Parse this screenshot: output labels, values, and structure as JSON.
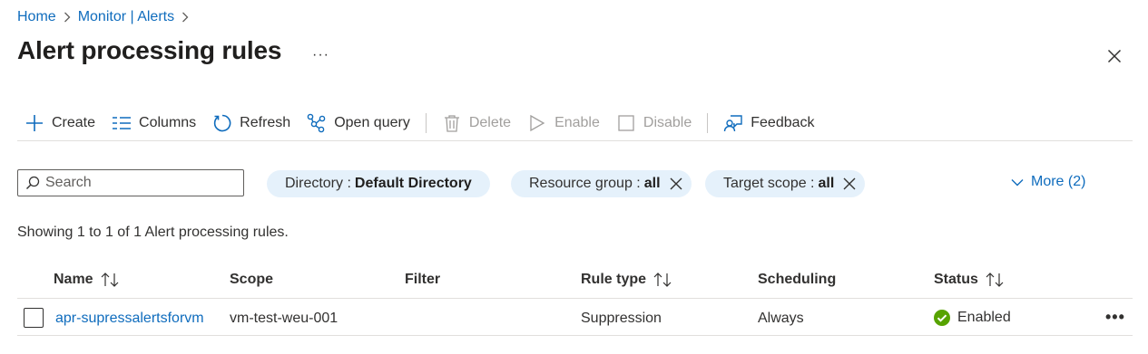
{
  "breadcrumb": {
    "items": [
      "Home",
      "Monitor | Alerts"
    ]
  },
  "page": {
    "title": "Alert processing rules",
    "title_more": "···"
  },
  "toolbar": {
    "create": "Create",
    "columns": "Columns",
    "refresh": "Refresh",
    "open_query": "Open query",
    "delete": "Delete",
    "enable": "Enable",
    "disable": "Disable",
    "feedback": "Feedback"
  },
  "search": {
    "placeholder": "Search"
  },
  "filters": {
    "directory": {
      "label": "Directory :",
      "value": "Default Directory"
    },
    "resource_group": {
      "label": "Resource group :",
      "value": "all"
    },
    "target_scope": {
      "label": "Target scope :",
      "value": "all"
    },
    "more": "More (2)"
  },
  "summary": "Showing 1 to 1 of 1 Alert processing rules.",
  "table": {
    "columns": [
      "Name",
      "Scope",
      "Filter",
      "Rule type",
      "Scheduling",
      "Status"
    ],
    "rows": [
      {
        "name": "apr-supressalertsforvm",
        "scope": "vm-test-weu-001",
        "filter": "",
        "rule_type": "Suppression",
        "scheduling": "Always",
        "status": "Enabled",
        "more": "•••"
      }
    ]
  },
  "colors": {
    "link": "#0f6cbd",
    "pill_bg": "#e5f1fb",
    "status_ok": "#57a300",
    "text": "#323130",
    "disabled": "#a19f9d"
  }
}
